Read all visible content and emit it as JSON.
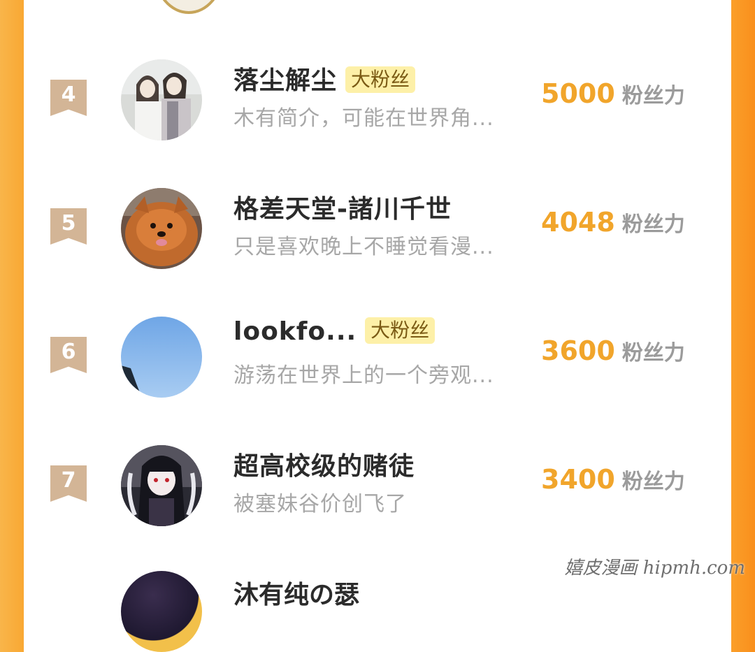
{
  "leaderboard": {
    "score_unit": "粉丝力",
    "badge_label": "大粉丝",
    "rows": [
      {
        "rank": "4",
        "name": "落尘解尘",
        "has_badge": true,
        "bio": "木有简介，可能在世界角...",
        "score": "5000"
      },
      {
        "rank": "5",
        "name": "格差天堂-諸川千世",
        "has_badge": false,
        "bio": "只是喜欢晚上不睡觉看漫...",
        "score": "4048"
      },
      {
        "rank": "6",
        "name": "lookfo...",
        "has_badge": true,
        "bio": "游荡在世界上的一个旁观...",
        "score": "3600"
      },
      {
        "rank": "7",
        "name": "超高校级的赌徒",
        "has_badge": false,
        "bio": "被塞妹谷价创飞了",
        "score": "3400"
      }
    ],
    "partial_next_name": "沐有纯の瑟"
  },
  "watermark": "嬉皮漫画 hipmh.com",
  "colors": {
    "accent_orange": "#f1a52b",
    "badge_bg": "#fdf0a8",
    "rank_ribbon": "#d3b596",
    "side_frame": "#f9a833"
  }
}
